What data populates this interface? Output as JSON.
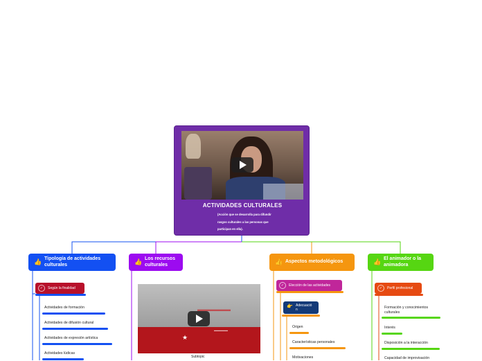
{
  "central": {
    "title": "ACTIVIDADES CULTURALES",
    "subtitle": "(Acción que se desarrolla para difundir rasgos culturales a las personas que participan en ella).",
    "color": "#6f2da8",
    "video_icon": "play-icon"
  },
  "branches": [
    {
      "title": "Tipología de actividades culturales",
      "color": "#1350f2",
      "icon": "thumbs-up-icon",
      "subtopic": {
        "label": "Según la finalidad",
        "color": "#b8102a",
        "icon": "check-circle-icon"
      },
      "leaves": [
        "Actividades de formación",
        "Actividades de difusión cultural",
        "Actividades de expresión artística",
        "Actividades lúdicas"
      ]
    },
    {
      "title": "Los recursos culturales",
      "color": "#9c0bf0",
      "icon": "thumbs-up-icon",
      "video_icon": "play-icon",
      "subtopic_label": "Subtopic"
    },
    {
      "title": "Aspectos metodológicos",
      "color": "#f5960f",
      "icon": "thumbs-up-icon",
      "subtopic": {
        "label": "Elección de las actividades",
        "color": "#c0269a",
        "icon": "check-circle-icon"
      },
      "child": {
        "label": "Adecuación",
        "color": "#143a78",
        "icon": "hand-point-icon"
      },
      "leaves": [
        "Origen",
        "Características personales",
        "Motivaciones"
      ]
    },
    {
      "title": "El animador o la animadora",
      "color": "#56d612",
      "icon": "thumbs-up-icon",
      "subtopic": {
        "label": "Perfil profesional",
        "color": "#e64a12",
        "icon": "check-circle-icon"
      },
      "leaves": [
        "Formación y conocimientos culturales",
        "Interés",
        "Disposición a la interacción",
        "Capacidad de improvisación"
      ]
    }
  ]
}
